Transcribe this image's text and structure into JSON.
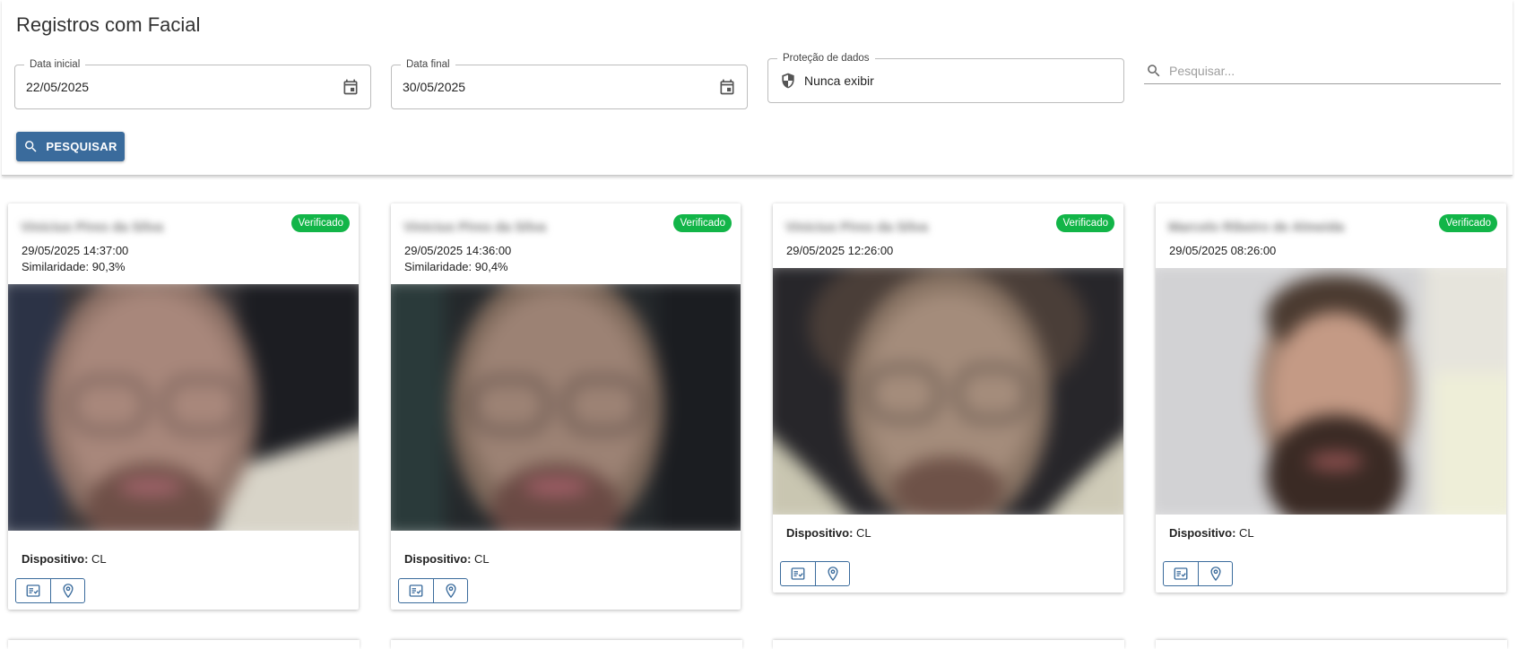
{
  "page": {
    "title": "Registros com Facial"
  },
  "filters": {
    "start_date": {
      "label": "Data inicial",
      "value": "22/05/2025"
    },
    "end_date": {
      "label": "Data final",
      "value": "30/05/2025"
    },
    "privacy": {
      "label": "Proteção de dados",
      "value": "Nunca exibir"
    },
    "search": {
      "placeholder": "Pesquisar..."
    },
    "search_button": "PESQUISAR"
  },
  "labels": {
    "device": "Dispositivo:"
  },
  "colors": {
    "primary": "#3a6b9c",
    "verified": "#12b548"
  },
  "records": [
    {
      "name": "Vinicius Pires da Silva",
      "badge": "Verificado",
      "datetime": "29/05/2025 14:37:00",
      "similarity": "Similaridade: 90,3%",
      "device": "CL"
    },
    {
      "name": "Vinicius Pires da Silva",
      "badge": "Verificado",
      "datetime": "29/05/2025 14:36:00",
      "similarity": "Similaridade: 90,4%",
      "device": "CL"
    },
    {
      "name": "Vinicius Pires da Silva",
      "badge": "Verificado",
      "datetime": "29/05/2025 12:26:00",
      "device": "CL"
    },
    {
      "name": "Marcelo Ribeiro de Almeida",
      "badge": "Verificado",
      "datetime": "29/05/2025 08:26:00",
      "device": "CL"
    }
  ],
  "icons": {
    "calendar": "calendar-icon",
    "shield": "shield-icon",
    "search": "search-icon",
    "checklist": "checklist-icon",
    "location": "location-pin-icon"
  }
}
